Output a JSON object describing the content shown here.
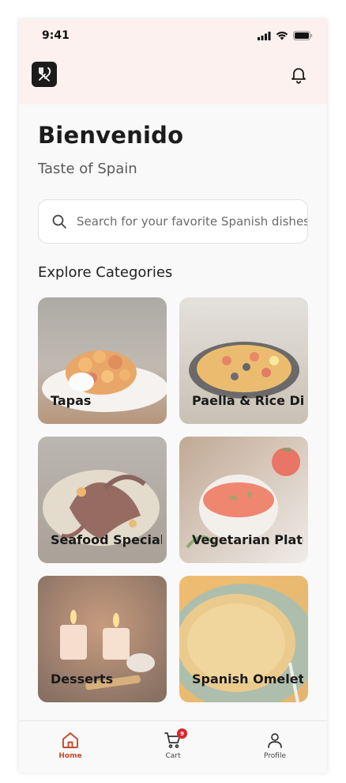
{
  "status_bar": {
    "time": "9:41"
  },
  "header": {
    "logo_icon": "fork-knife-icon",
    "notification_icon": "bell-icon"
  },
  "main": {
    "title": "Bienvenido",
    "subtitle": "Taste of Spain",
    "search": {
      "placeholder": "Search for your favorite Spanish dishes",
      "value": ""
    },
    "section_title": "Explore Categories",
    "categories": [
      {
        "label": "Tapas"
      },
      {
        "label": "Paella & Rice Dishes"
      },
      {
        "label": "Seafood Specialties"
      },
      {
        "label": "Vegetarian Plates"
      },
      {
        "label": "Desserts"
      },
      {
        "label": "Spanish Omelettes"
      }
    ]
  },
  "tabbar": {
    "items": [
      {
        "label": "Home",
        "icon": "home-icon",
        "active": true
      },
      {
        "label": "Cart",
        "icon": "cart-icon",
        "badge": "9"
      },
      {
        "label": "Profile",
        "icon": "profile-icon"
      }
    ]
  },
  "colors": {
    "accent": "#c8482c",
    "header_bg": "#fcf1ee",
    "badge": "#d8262c"
  }
}
